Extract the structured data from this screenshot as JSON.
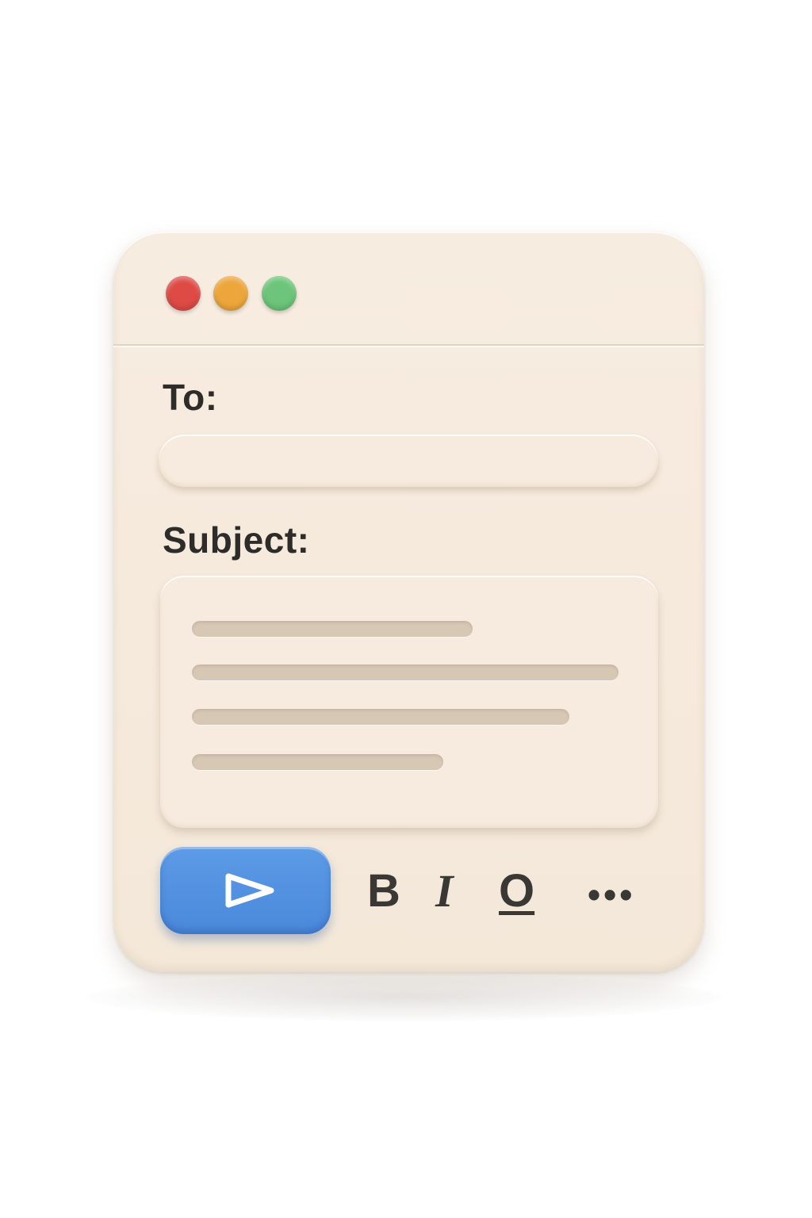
{
  "window": {
    "controls": [
      "close",
      "minimize",
      "maximize"
    ],
    "colors": {
      "close": "#de4a45",
      "minimize": "#eda63b",
      "maximize": "#6cc57a",
      "background": "#f4e8d9",
      "accent": "#4a88db"
    }
  },
  "compose": {
    "to_label": "To:",
    "to_value": "",
    "subject_label": "Subject:",
    "body_lines": 4
  },
  "toolbar": {
    "send_icon": "send-icon",
    "bold_label": "B",
    "italic_label": "I",
    "underline_label": "O",
    "more_label": "•••"
  }
}
